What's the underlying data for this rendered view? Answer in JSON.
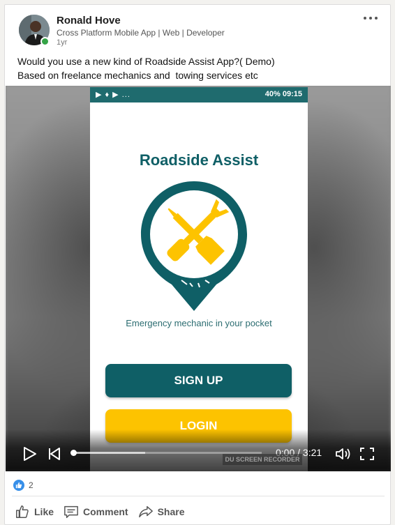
{
  "post": {
    "author": "Ronald Hove",
    "headline": "Cross Platform Mobile App | Web | Developer",
    "time": "1yr",
    "text_lines": [
      "Would you use a new kind of Roadside Assist App?( Demo)",
      "Based on freelance mechanics and  towing services etc"
    ]
  },
  "video": {
    "status_bar": {
      "left": "▶ ♦ ▶ ...",
      "right": "40% 09:15"
    },
    "app_title": "Roadside Assist",
    "tagline": "Emergency mechanic in your pocket",
    "signup_label": "SIGN UP",
    "login_label": "LOGIN",
    "watermark": "DU SCREEN RECORDER",
    "time_readout": "0:00 / 3:21",
    "progress": 0.0,
    "buffered": 0.38,
    "colors": {
      "teal": "#0f5f66",
      "yellow": "#fdc300"
    }
  },
  "social": {
    "reaction_count": "2",
    "actions": [
      {
        "label": "Like",
        "icon": "thumbs-up-icon"
      },
      {
        "label": "Comment",
        "icon": "comment-icon"
      },
      {
        "label": "Share",
        "icon": "share-icon"
      }
    ]
  }
}
